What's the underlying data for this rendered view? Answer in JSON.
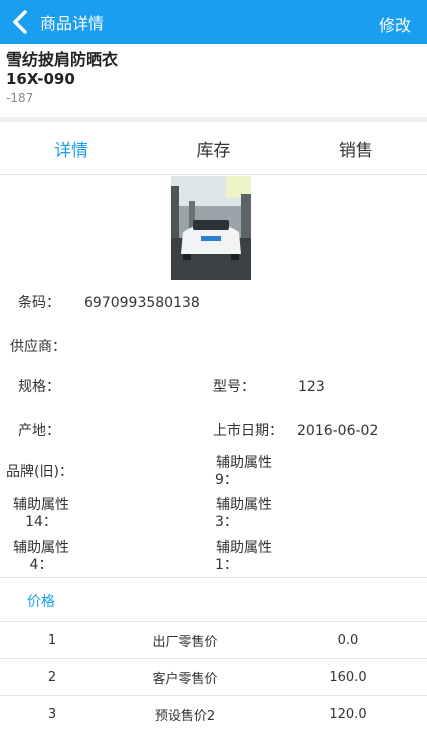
{
  "header": {
    "title": "商品详情",
    "edit_label": "修改"
  },
  "product": {
    "name": "雪纺披肩防晒衣",
    "code": "16X-090",
    "sub": "-187"
  },
  "tabs": [
    {
      "label": "详情",
      "active": true
    },
    {
      "label": "库存",
      "active": false
    },
    {
      "label": "销售",
      "active": false
    }
  ],
  "details": {
    "barcode_label": "条码：",
    "barcode_value": "6970993580138",
    "supplier_label": "供应商：",
    "spec_label": "规格：",
    "model_label": "型号：",
    "model_value": "123",
    "origin_label": "产地：",
    "launch_label": "上市日期：",
    "launch_value": "2016-06-02",
    "brand_label": "品牌(旧)：",
    "aux9_l1": "辅助属性",
    "aux9_l2": "9：",
    "aux14_l1": "辅助属性",
    "aux14_l2": "14：",
    "aux3_l1": "辅助属性",
    "aux3_l2": "3：",
    "aux4_l1": "辅助属性",
    "aux4_l2": "4：",
    "aux1_l1": "辅助属性",
    "aux1_l2": "1："
  },
  "price": {
    "heading": "价格",
    "rows": [
      {
        "no": "1",
        "name": "出厂零售价",
        "value": "0.0"
      },
      {
        "no": "2",
        "name": "客户零售价",
        "value": "160.0"
      },
      {
        "no": "3",
        "name": "预设售价2",
        "value": "120.0"
      }
    ]
  },
  "colors": {
    "accent": "#1a9ef0",
    "separator": "#eef0f1"
  }
}
